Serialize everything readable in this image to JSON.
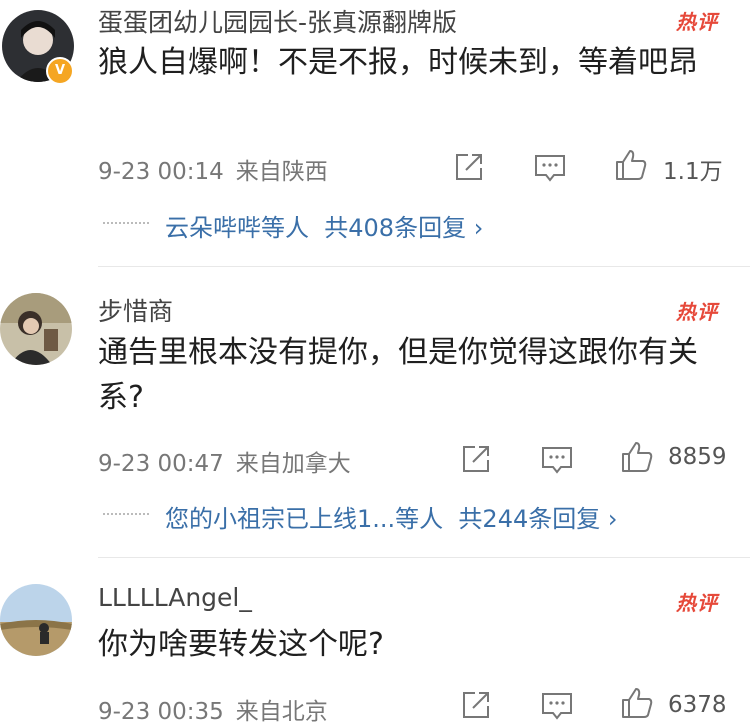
{
  "comments": [
    {
      "username": "蛋蛋团幼儿园园长-张真源翻牌版",
      "hot_label": "热评",
      "text": "狼人自爆啊！不是不报，时候未到，等着吧昂",
      "time": "9-23 00:14",
      "location": "来自陕西",
      "likes": "1.1万",
      "reply_users": "云朵哔哔等人",
      "reply_count": "共408条回复",
      "verified_badge": "V"
    },
    {
      "username": "步惜商",
      "hot_label": "热评",
      "text": "通告里根本没有提你，但是你觉得这跟你有关系?",
      "time": "9-23 00:47",
      "location": "来自加拿大",
      "likes": "8859",
      "reply_users": "您的小祖宗已上线1...等人",
      "reply_count": "共244条回复"
    },
    {
      "username": "LLLLLAngel_",
      "hot_label": "热评",
      "text": "你为啥要转发这个呢?",
      "time": "9-23 00:35",
      "location": "来自北京",
      "likes": "6378"
    }
  ],
  "icons": {
    "share": "share-icon",
    "comment": "comment-icon",
    "like": "like-icon",
    "reply_arrow": "chevron-right-icon"
  },
  "colors": {
    "hot": "#e6493a",
    "reply_link": "#3a6fa8",
    "verified": "#f5a623"
  }
}
